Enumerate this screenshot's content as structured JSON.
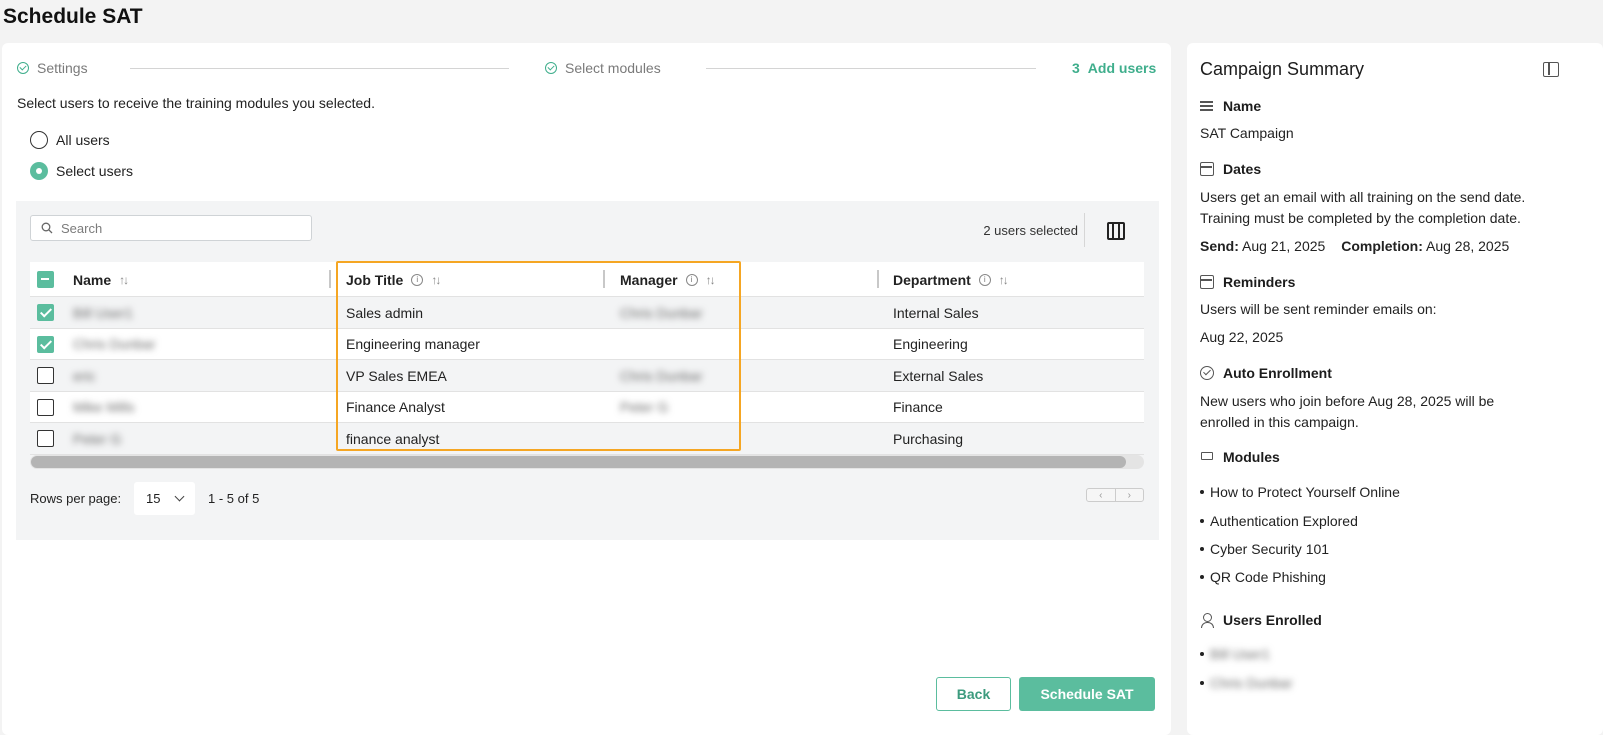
{
  "page": {
    "title": "Schedule SAT"
  },
  "stepper": {
    "steps": [
      {
        "label": "Settings",
        "state": "done"
      },
      {
        "label": "Select modules",
        "state": "done"
      },
      {
        "number": "3",
        "label": "Add users",
        "state": "active"
      }
    ]
  },
  "intro": "Select users to receive the training modules you selected.",
  "audience": {
    "options": [
      {
        "label": "All users",
        "selected": false
      },
      {
        "label": "Select users",
        "selected": true
      }
    ]
  },
  "table": {
    "search_placeholder": "Search",
    "selected_count": "2 users selected",
    "columns": [
      "Name",
      "Job Title",
      "Manager",
      "Department"
    ],
    "rows": [
      {
        "checked": true,
        "name": "Bill User1",
        "job_title": "Sales admin",
        "manager": "Chris Dunbar",
        "department": "Internal Sales"
      },
      {
        "checked": true,
        "name": "Chris Dunbar",
        "job_title": "Engineering manager",
        "manager": "",
        "department": "Engineering"
      },
      {
        "checked": false,
        "name": "eric",
        "job_title": "VP Sales EMEA",
        "manager": "Chris Dunbar",
        "department": "External Sales"
      },
      {
        "checked": false,
        "name": "Mike Mills",
        "job_title": "Finance Analyst",
        "manager": "Peter G",
        "department": "Finance"
      },
      {
        "checked": false,
        "name": "Peter G",
        "job_title": "finance analyst",
        "manager": "",
        "department": "Purchasing"
      }
    ],
    "rows_per_page_label": "Rows per page:",
    "rows_per_page_value": "15",
    "range": "1 - 5 of 5"
  },
  "buttons": {
    "back": "Back",
    "schedule": "Schedule SAT"
  },
  "summary": {
    "title": "Campaign Summary",
    "name_heading": "Name",
    "name_value": "SAT Campaign",
    "dates_heading": "Dates",
    "dates_line1": "Users get an email with all training on the send date.",
    "dates_line2": "Training must be completed by the completion date.",
    "send_label": "Send:",
    "send_value": "Aug 21, 2025",
    "completion_label": "Completion:",
    "completion_value": "Aug 28, 2025",
    "reminders_heading": "Reminders",
    "reminders_text": "Users will be sent reminder emails on:",
    "reminders_date": "Aug 22, 2025",
    "auto_heading": "Auto Enrollment",
    "auto_line1": "New users who join before Aug 28, 2025 will be",
    "auto_line2": "enrolled in this campaign.",
    "modules_heading": "Modules",
    "modules": [
      "How to Protect Yourself Online",
      "Authentication Explored",
      "Cyber Security 101",
      "QR Code Phishing"
    ],
    "users_heading": "Users Enrolled",
    "users": [
      "Bill User1",
      "Chris Dunbar"
    ]
  },
  "colors": {
    "accent": "#5bbd9e",
    "highlight": "#f5a623"
  }
}
